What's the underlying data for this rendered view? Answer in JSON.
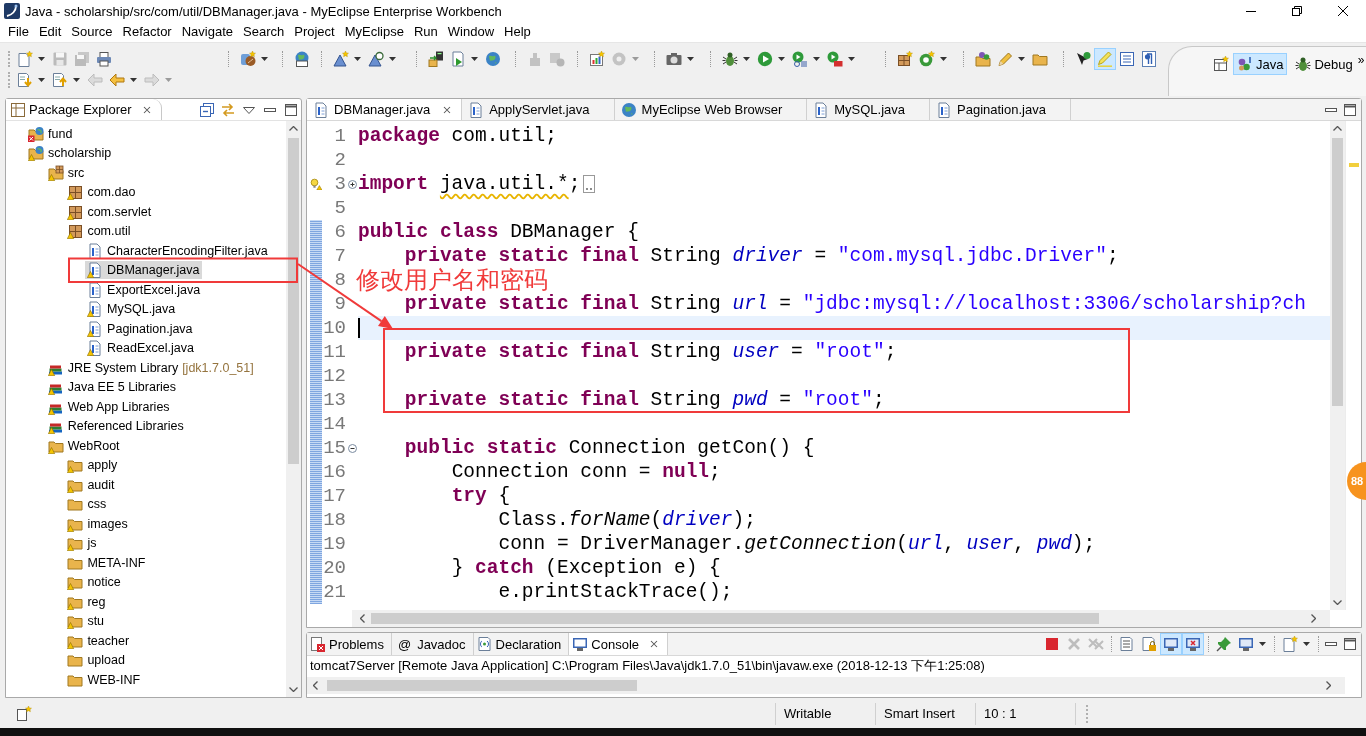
{
  "window": {
    "title": "Java - scholarship/src/com/util/DBManager.java - MyEclipse Enterprise Workbench"
  },
  "menu": [
    "File",
    "Edit",
    "Source",
    "Refactor",
    "Navigate",
    "Search",
    "Project",
    "MyEclipse",
    "Run",
    "Window",
    "Help"
  ],
  "toolbar": {
    "rows": [
      {
        "groups": [
          [
            {
              "disabled": false,
              "dropdown": true,
              "pressed": false
            },
            {
              "disabled": true,
              "dropdown": false,
              "pressed": false
            },
            {
              "disabled": true,
              "dropdown": false,
              "pressed": false
            },
            {
              "disabled": false,
              "dropdown": false,
              "pressed": false
            }
          ],
          [
            {
              "disabled": false,
              "dropdown": true,
              "pressed": false
            }
          ],
          [
            {
              "disabled": false,
              "dropdown": false,
              "pressed": false
            }
          ],
          [
            {
              "disabled": false,
              "dropdown": true,
              "pressed": false
            },
            {
              "disabled": false,
              "dropdown": true,
              "pressed": false
            }
          ],
          [
            {
              "disabled": false,
              "dropdown": false,
              "pressed": false
            },
            {
              "disabled": false,
              "dropdown": true,
              "pressed": false
            },
            {
              "disabled": false,
              "dropdown": false,
              "pressed": false
            }
          ],
          [
            {
              "disabled": true,
              "dropdown": false,
              "pressed": false
            },
            {
              "disabled": true,
              "dropdown": false,
              "pressed": false
            }
          ],
          [
            {
              "disabled": false,
              "dropdown": false,
              "pressed": false
            },
            {
              "disabled": true,
              "dropdown": true,
              "pressed": false
            }
          ],
          [
            {
              "disabled": false,
              "dropdown": true,
              "pressed": false
            }
          ],
          [
            {
              "disabled": false,
              "dropdown": true,
              "pressed": false
            },
            {
              "disabled": false,
              "dropdown": true,
              "pressed": false
            },
            {
              "disabled": false,
              "dropdown": true,
              "pressed": false
            },
            {
              "disabled": false,
              "dropdown": true,
              "pressed": false
            }
          ],
          [
            {
              "disabled": false,
              "dropdown": false,
              "pressed": false
            },
            {
              "disabled": false,
              "dropdown": true,
              "pressed": false
            }
          ],
          [
            {
              "disabled": false,
              "dropdown": false,
              "pressed": false
            },
            {
              "disabled": false,
              "dropdown": true,
              "pressed": false
            },
            {
              "disabled": false,
              "dropdown": false,
              "pressed": false
            }
          ],
          [
            {
              "disabled": false,
              "dropdown": false,
              "pressed": false
            },
            {
              "disabled": false,
              "dropdown": false,
              "pressed": true
            },
            {
              "disabled": false,
              "dropdown": false,
              "pressed": false
            },
            {
              "disabled": false,
              "dropdown": false,
              "pressed": false
            }
          ]
        ]
      },
      {
        "groups": [
          [
            {
              "disabled": false,
              "dropdown": true,
              "pressed": false
            },
            {
              "disabled": false,
              "dropdown": true,
              "pressed": false
            },
            {
              "disabled": true,
              "dropdown": false,
              "pressed": false
            },
            {
              "disabled": false,
              "dropdown": true,
              "pressed": false
            },
            {
              "disabled": true,
              "dropdown": true,
              "pressed": false
            }
          ]
        ]
      }
    ]
  },
  "perspectives": {
    "items": [
      {
        "label": "Java",
        "kind": "java",
        "selected": true
      },
      {
        "label": "Debug",
        "kind": "debug",
        "selected": false
      }
    ],
    "overflow": "»"
  },
  "package_explorer": {
    "title": "Package Explorer",
    "tree": [
      {
        "label": "fund",
        "kind": "project",
        "warning": false,
        "error": true,
        "selected": false
      },
      {
        "label": "scholarship",
        "kind": "project",
        "warning": true,
        "error": false,
        "selected": false,
        "children": [
          {
            "label": "src",
            "kind": "source-folder",
            "warning": true,
            "error": false,
            "selected": false,
            "children": [
              {
                "label": "com.dao",
                "kind": "package",
                "warning": true,
                "error": false,
                "selected": false
              },
              {
                "label": "com.servlet",
                "kind": "package",
                "warning": true,
                "error": false,
                "selected": false
              },
              {
                "label": "com.util",
                "kind": "package",
                "warning": true,
                "error": false,
                "selected": false,
                "children": [
                  {
                    "label": "CharacterEncodingFilter.java",
                    "kind": "java-file",
                    "warning": false,
                    "error": false,
                    "selected": false
                  },
                  {
                    "label": "DBManager.java",
                    "kind": "java-file",
                    "warning": true,
                    "error": false,
                    "selected": true
                  },
                  {
                    "label": "ExportExcel.java",
                    "kind": "java-file",
                    "warning": false,
                    "error": false,
                    "selected": false
                  },
                  {
                    "label": "MySQL.java",
                    "kind": "java-file",
                    "warning": true,
                    "error": false,
                    "selected": false
                  },
                  {
                    "label": "Pagination.java",
                    "kind": "java-file",
                    "warning": true,
                    "error": false,
                    "selected": false
                  },
                  {
                    "label": "ReadExcel.java",
                    "kind": "java-file",
                    "warning": true,
                    "error": false,
                    "selected": false
                  }
                ]
              }
            ]
          },
          {
            "label": "JRE System Library",
            "decoration": "[jdk1.7.0_51]",
            "kind": "library",
            "warning": true,
            "error": false,
            "selected": false
          },
          {
            "label": "Java EE 5 Libraries",
            "kind": "library",
            "warning": true,
            "error": false,
            "selected": false
          },
          {
            "label": "Web App Libraries",
            "kind": "library",
            "warning": true,
            "error": false,
            "selected": false
          },
          {
            "label": "Referenced Libraries",
            "kind": "library",
            "warning": true,
            "error": false,
            "selected": false
          },
          {
            "label": "WebRoot",
            "kind": "folder",
            "warning": true,
            "error": false,
            "selected": false,
            "children": [
              {
                "label": "apply",
                "kind": "folder",
                "warning": true,
                "error": false,
                "selected": false
              },
              {
                "label": "audit",
                "kind": "folder",
                "warning": true,
                "error": false,
                "selected": false
              },
              {
                "label": "css",
                "kind": "folder",
                "warning": false,
                "error": false,
                "selected": false
              },
              {
                "label": "images",
                "kind": "folder",
                "warning": true,
                "error": false,
                "selected": false
              },
              {
                "label": "js",
                "kind": "folder",
                "warning": true,
                "error": false,
                "selected": false
              },
              {
                "label": "META-INF",
                "kind": "folder",
                "warning": false,
                "error": false,
                "selected": false
              },
              {
                "label": "notice",
                "kind": "folder",
                "warning": true,
                "error": false,
                "selected": false
              },
              {
                "label": "reg",
                "kind": "folder",
                "warning": true,
                "error": false,
                "selected": false
              },
              {
                "label": "stu",
                "kind": "folder",
                "warning": true,
                "error": false,
                "selected": false
              },
              {
                "label": "teacher",
                "kind": "folder",
                "warning": true,
                "error": false,
                "selected": false
              },
              {
                "label": "upload",
                "kind": "folder",
                "warning": false,
                "error": false,
                "selected": false
              },
              {
                "label": "WEB-INF",
                "kind": "folder",
                "warning": false,
                "error": false,
                "selected": false
              }
            ]
          }
        ]
      }
    ]
  },
  "editor": {
    "tabs": [
      {
        "label": "DBManager.java",
        "kind": "java",
        "selected": true
      },
      {
        "label": "ApplyServlet.java",
        "kind": "java",
        "selected": false
      },
      {
        "label": "MyEclipse Web Browser",
        "kind": "browser",
        "selected": false
      },
      {
        "label": "MySQL.java",
        "kind": "java",
        "selected": false
      },
      {
        "label": "Pagination.java",
        "kind": "java",
        "selected": false
      }
    ],
    "lines": [
      {
        "number": "1",
        "tokens": [
          {
            "kind": "keyword",
            "text": "package"
          },
          {
            "kind": "plain",
            "text": " com.util;"
          }
        ],
        "current": false,
        "changed": false,
        "warning": false,
        "collapsible": false
      },
      {
        "number": "2",
        "current": false,
        "changed": false,
        "warning": false,
        "collapsible": false
      },
      {
        "number": "3",
        "tokens": [
          {
            "kind": "keyword",
            "text": "import "
          },
          {
            "kind": "warned",
            "text": "java.util.*"
          },
          {
            "kind": "plain",
            "text": ";"
          }
        ],
        "current": false,
        "changed": false,
        "warning": true,
        "collapsible": true,
        "collapsed": true
      },
      {
        "number": "5",
        "current": false,
        "changed": false,
        "warning": false,
        "collapsible": false
      },
      {
        "number": "6",
        "tokens": [
          {
            "kind": "keyword",
            "text": "public class"
          },
          {
            "kind": "plain",
            "text": " DBManager {"
          }
        ],
        "current": false,
        "changed": true,
        "warning": false,
        "collapsible": false
      },
      {
        "number": "7",
        "tokens": [
          {
            "kind": "keyword",
            "text": "    private static final"
          },
          {
            "kind": "plain",
            "text": " String "
          },
          {
            "kind": "field",
            "text": "driver"
          },
          {
            "kind": "plain",
            "text": " = "
          },
          {
            "kind": "string",
            "text": "\"com.mysql.jdbc.Driver\""
          },
          {
            "kind": "plain",
            "text": ";"
          }
        ],
        "current": false,
        "changed": true,
        "warning": false,
        "collapsible": false
      },
      {
        "number": "8",
        "current": false,
        "changed": true,
        "warning": false,
        "collapsible": false
      },
      {
        "number": "9",
        "tokens": [
          {
            "kind": "keyword",
            "text": "    private static final"
          },
          {
            "kind": "plain",
            "text": " String "
          },
          {
            "kind": "field",
            "text": "url"
          },
          {
            "kind": "plain",
            "text": " = "
          },
          {
            "kind": "string",
            "text": "\"jdbc:mysql://localhost:3306/scholarship?ch"
          }
        ],
        "current": false,
        "changed": true,
        "warning": false,
        "collapsible": false
      },
      {
        "number": "10",
        "current": true,
        "changed": true,
        "warning": false,
        "collapsible": false
      },
      {
        "number": "11",
        "tokens": [
          {
            "kind": "keyword",
            "text": "    private static final"
          },
          {
            "kind": "plain",
            "text": " String "
          },
          {
            "kind": "field",
            "text": "user"
          },
          {
            "kind": "plain",
            "text": " = "
          },
          {
            "kind": "string",
            "text": "\"root\""
          },
          {
            "kind": "plain",
            "text": ";"
          }
        ],
        "current": false,
        "changed": true,
        "warning": false,
        "collapsible": false
      },
      {
        "number": "12",
        "current": false,
        "changed": true,
        "warning": false,
        "collapsible": false
      },
      {
        "number": "13",
        "tokens": [
          {
            "kind": "keyword",
            "text": "    private static final"
          },
          {
            "kind": "plain",
            "text": " String "
          },
          {
            "kind": "field",
            "text": "pwd"
          },
          {
            "kind": "plain",
            "text": " = "
          },
          {
            "kind": "string",
            "text": "\"root\""
          },
          {
            "kind": "plain",
            "text": ";"
          }
        ],
        "current": false,
        "changed": true,
        "warning": false,
        "collapsible": false
      },
      {
        "number": "14",
        "current": false,
        "changed": true,
        "warning": false,
        "collapsible": false
      },
      {
        "number": "15",
        "tokens": [
          {
            "kind": "keyword",
            "text": "    public static"
          },
          {
            "kind": "plain",
            "text": " Connection getCon() {"
          }
        ],
        "current": false,
        "changed": true,
        "warning": false,
        "collapsible": true,
        "collapsed": false
      },
      {
        "number": "16",
        "tokens": [
          {
            "kind": "plain",
            "text": "        Connection conn = "
          },
          {
            "kind": "keyword",
            "text": "null"
          },
          {
            "kind": "plain",
            "text": ";"
          }
        ],
        "current": false,
        "changed": true,
        "warning": false,
        "collapsible": false
      },
      {
        "number": "17",
        "tokens": [
          {
            "kind": "keyword",
            "text": "        try"
          },
          {
            "kind": "plain",
            "text": " {"
          }
        ],
        "current": false,
        "changed": true,
        "warning": false,
        "collapsible": false
      },
      {
        "number": "18",
        "tokens": [
          {
            "kind": "plain",
            "text": "            Class."
          },
          {
            "kind": "method",
            "text": "forName"
          },
          {
            "kind": "plain",
            "text": "("
          },
          {
            "kind": "field",
            "text": "driver"
          },
          {
            "kind": "plain",
            "text": ");"
          }
        ],
        "current": false,
        "changed": true,
        "warning": false,
        "collapsible": false
      },
      {
        "number": "19",
        "tokens": [
          {
            "kind": "plain",
            "text": "            conn = DriverManager."
          },
          {
            "kind": "method",
            "text": "getConnection"
          },
          {
            "kind": "plain",
            "text": "("
          },
          {
            "kind": "field",
            "text": "url"
          },
          {
            "kind": "plain",
            "text": ", "
          },
          {
            "kind": "field",
            "text": "user"
          },
          {
            "kind": "plain",
            "text": ", "
          },
          {
            "kind": "field",
            "text": "pwd"
          },
          {
            "kind": "plain",
            "text": ");"
          }
        ],
        "current": false,
        "changed": true,
        "warning": false,
        "collapsible": false
      },
      {
        "number": "20",
        "tokens": [
          {
            "kind": "plain",
            "text": "        } "
          },
          {
            "kind": "keyword",
            "text": "catch"
          },
          {
            "kind": "plain",
            "text": " (Exception e) {"
          }
        ],
        "current": false,
        "changed": true,
        "warning": false,
        "collapsible": false
      },
      {
        "number": "21",
        "tokens": [
          {
            "kind": "plain",
            "text": "            e.printStackTrace();"
          }
        ],
        "current": false,
        "changed": true,
        "warning": false,
        "collapsible": false
      }
    ]
  },
  "annotation": {
    "note": "修改用户名和密码"
  },
  "console_view": {
    "tabs": [
      {
        "label": "Problems",
        "kind": "problems",
        "selected": false
      },
      {
        "label": "Javadoc",
        "kind": "javadoc",
        "glyph": "@",
        "selected": false
      },
      {
        "label": "Declaration",
        "kind": "declaration",
        "selected": false
      },
      {
        "label": "Console",
        "kind": "console",
        "selected": true
      }
    ],
    "toolbar": [
      [
        {
          "disabled": false,
          "dropdown": false,
          "pressed": false
        },
        {
          "disabled": true,
          "dropdown": false,
          "pressed": false
        },
        {
          "disabled": true,
          "dropdown": false,
          "pressed": false
        }
      ],
      [
        {
          "disabled": false,
          "dropdown": false,
          "pressed": false
        },
        {
          "disabled": false,
          "dropdown": false,
          "pressed": false
        },
        {
          "disabled": false,
          "dropdown": false,
          "pressed": true
        },
        {
          "disabled": false,
          "dropdown": false,
          "pressed": true
        }
      ],
      [
        {
          "disabled": false,
          "dropdown": false,
          "pressed": false
        },
        {
          "disabled": false,
          "dropdown": true,
          "pressed": false
        }
      ],
      [
        {
          "disabled": false,
          "dropdown": true,
          "pressed": false
        }
      ]
    ],
    "text": "tomcat7Server [Remote Java Application] C:\\Program Files\\Java\\jdk1.7.0_51\\bin\\javaw.exe (2018-12-13 下午1:25:08)"
  },
  "status_bar": {
    "fields": [
      "Writable",
      "Smart Insert",
      "10 : 1"
    ]
  },
  "floating_badge": {
    "count": "88"
  }
}
